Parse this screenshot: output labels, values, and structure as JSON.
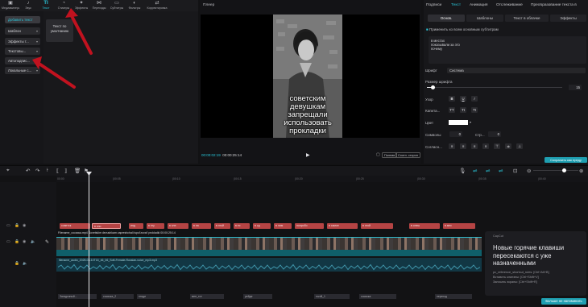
{
  "toolbar": {
    "tools": [
      {
        "label": "Медиаматериалы",
        "icon": "media-icon"
      },
      {
        "label": "Звук",
        "icon": "audio-icon"
      },
      {
        "label": "Текст",
        "icon": "text-icon",
        "active": true
      },
      {
        "label": "Стикеры",
        "icon": "sticker-icon"
      },
      {
        "label": "Эффекты",
        "icon": "effects-icon"
      },
      {
        "label": "Переходы",
        "icon": "transition-icon"
      },
      {
        "label": "Субтитры",
        "icon": "subtitle-icon"
      },
      {
        "label": "Фильтры",
        "icon": "filter-icon"
      },
      {
        "label": "Корректировка",
        "icon": "adjust-icon"
      }
    ]
  },
  "left_nav": {
    "items": [
      {
        "label": "Добавить текст",
        "selected": true
      },
      {
        "label": "Шаблон",
        "caret": true
      },
      {
        "label": "Эффекты т...",
        "caret": true
      },
      {
        "label": "Текстовы...",
        "caret": true
      },
      {
        "label": "Автоподпис..."
      },
      {
        "label": "Локальные с...",
        "caret": true
      }
    ]
  },
  "text_card": {
    "label": "Текст по умолчанию"
  },
  "player": {
    "title": "Плеер",
    "caption_lines": [
      "советским",
      "девушкам",
      "запрещали",
      "использовать",
      "прокладки"
    ],
    "current_time": "00:00:02:19",
    "total_time": "00:00:25:14",
    "buttons": {
      "full": "Полная",
      "ratio": "Соотн. сторон"
    }
  },
  "inspector": {
    "tabs": [
      "Подписи",
      "Текст",
      "Анимация",
      "Отслеживание",
      "Преобразование текста в"
    ],
    "active_tab": "Текст",
    "subtabs": [
      "Основ.",
      "Шаблоны",
      "Текст в облачке",
      "Эффекты"
    ],
    "apply_all_label": "Применить ко всем основным субтитрам",
    "text_lines": [
      "в местах",
      "показывали за это",
      "почему"
    ],
    "font_label": "Шрифт",
    "font_value": "Система",
    "size_label": "Размер шрифта",
    "size_value": "15",
    "style_label": "Узор",
    "style_buttons": [
      "B",
      "U",
      "I"
    ],
    "case_label": "Капита...",
    "case_buttons": [
      "TT",
      "Tt",
      "Tt"
    ],
    "color_label": "Цвет",
    "spacing_label": "Символы",
    "spacing_value": "0",
    "line_label": "Стр...",
    "line_value": "0",
    "align_label": "Согласн...",
    "save_button": "Сохранить как преду",
    "colors": {
      "accent": "#29c3d6",
      "text_color": "#ffffff"
    }
  },
  "timeline": {
    "ruler_ticks": [
      "00:00",
      "|00:05",
      "|00:10",
      "|00:15",
      "|00:20",
      "|00:25",
      "|00:30",
      "|00:35",
      "|00:40",
      "|00:45"
    ],
    "subtitle_clips": [
      "советск",
      "в спо",
      "инд",
      "в эту",
      "в эле",
      "в на",
      "в этой",
      "в ес",
      "в сд",
      "в лим",
      "попробо",
      "в самое",
      "в этой",
      "в спеш",
      "в мес"
    ],
    "video_title": "Filename_сосиска.mp4  Sovetskim devushkam zapreshchali ispol'zovat' prokladki  00:00:25:14",
    "audio_title": "filename_audio_2025-03-10T16_46_06_Soft-Female-Russian-voice_mp3.mp3",
    "bottom_clips": [
      "Загадочный...",
      "сосиска_2",
      "гляди",
      "мне_тот",
      "рейде",
      "rozdil_1",
      "сосиска",
      "переход"
    ]
  },
  "popup": {
    "brand": "CapCut",
    "title": "Новые горячие клавиши пересекаются с уже назначенными",
    "lines": [
      "pc_reference_shortcut_rules: [Ctrl+Alt+B]",
      "Вставить клипэпы: [Ctrl+Shift+V]",
      "Записать экраны: [Ctrl+Shift+R]"
    ],
    "ok_button": "Больше не напоминать"
  }
}
